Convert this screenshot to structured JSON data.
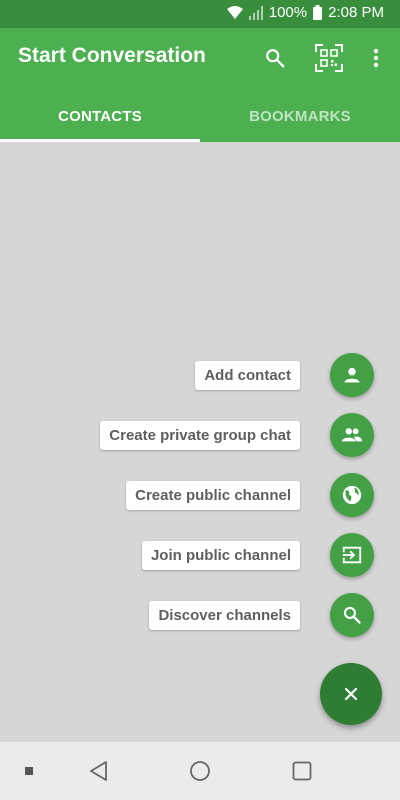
{
  "status_bar": {
    "battery": "100%",
    "time": "2:08 PM"
  },
  "app_bar": {
    "title": "Start Conversation",
    "icons": [
      "search-icon",
      "qr-code-icon",
      "more-vert-icon"
    ]
  },
  "tabs": [
    {
      "label": "CONTACTS",
      "selected": true
    },
    {
      "label": "BOOKMARKS",
      "selected": false
    }
  ],
  "speed_dial": {
    "actions": [
      {
        "label": "Add contact",
        "icon": "person-icon"
      },
      {
        "label": "Create private group chat",
        "icon": "group-icon"
      },
      {
        "label": "Create public channel",
        "icon": "globe-icon"
      },
      {
        "label": "Join public channel",
        "icon": "enter-icon"
      },
      {
        "label": "Discover channels",
        "icon": "search-icon"
      }
    ],
    "main_icon": "close-icon"
  },
  "colors": {
    "primary": "#4caf50",
    "primary_dark": "#388e3c",
    "fab": "#43a047",
    "fab_main": "#2e7d32",
    "background": "#d6d6d6"
  }
}
